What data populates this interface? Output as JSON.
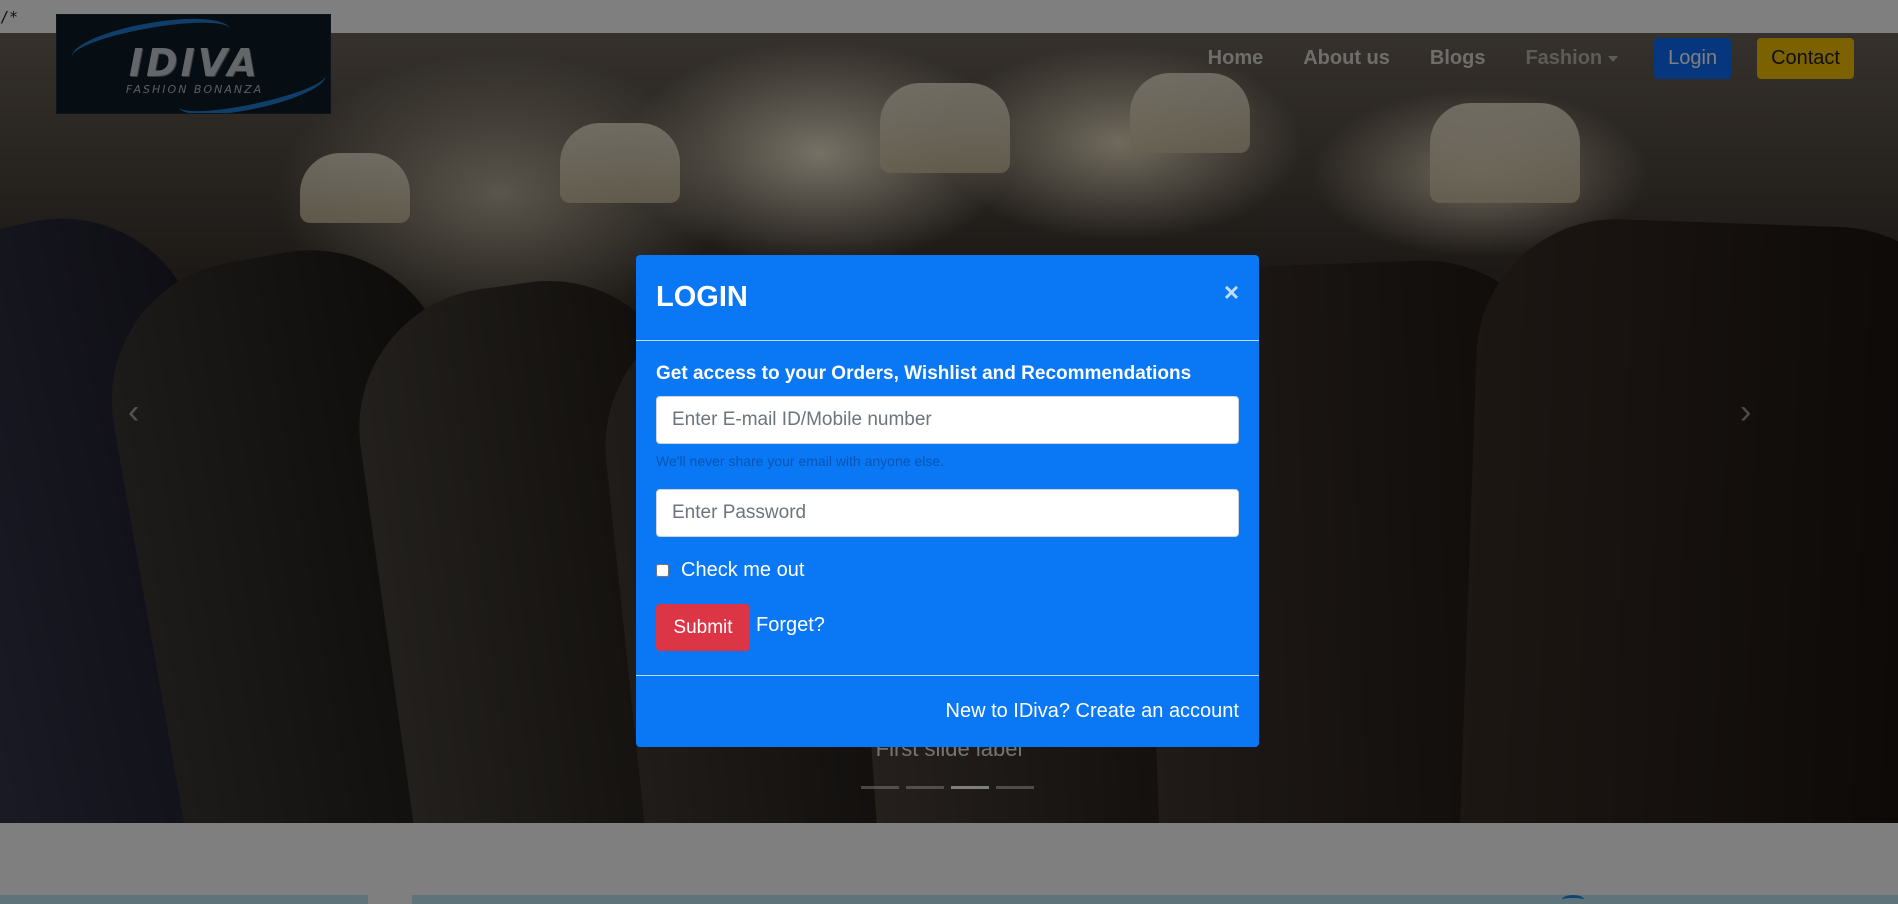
{
  "page": {
    "stray_text": "/*"
  },
  "navbar": {
    "logo": {
      "title": "IDIVA",
      "subtitle": "FASHION BONANZA"
    },
    "links": {
      "home": "Home",
      "about": "About us",
      "blogs": "Blogs",
      "fashion": "Fashion"
    },
    "login_button": "Login",
    "contact_button": "Contact"
  },
  "carousel": {
    "prev_icon": "‹",
    "next_icon": "›",
    "caption": "First slide label",
    "indicator_count": 4,
    "active_indicator": 3
  },
  "modal": {
    "title": "LOGIN",
    "close_icon": "×",
    "lead": "Get access to your Orders, Wishlist and Recommendations",
    "email_placeholder": "Enter E-mail ID/Mobile number",
    "email_hint": "We'll never share your email with anyone else.",
    "password_placeholder": "Enter Password",
    "checkbox_label": "Check me out",
    "submit_label": "Submit",
    "forget_link": "Forget?",
    "footer_link": "New to IDiva? Create an account"
  },
  "colors": {
    "modal_bg": "#0a77f5",
    "login_button": "#0d6efd",
    "contact_button": "#f7c200",
    "submit_button": "#dc3545"
  }
}
